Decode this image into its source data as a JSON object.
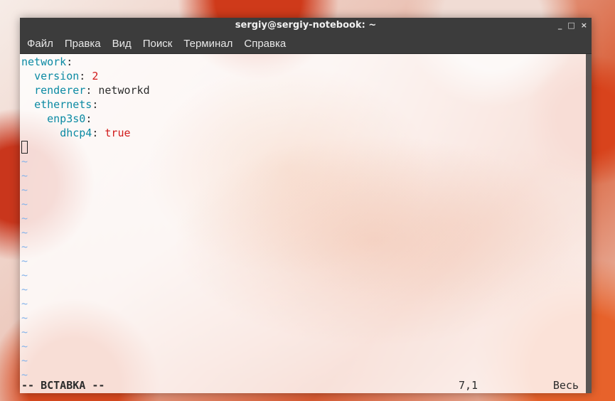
{
  "window": {
    "title": "sergiy@sergiy-notebook: ~",
    "controls": {
      "minimize": "_",
      "maximize": "□",
      "close": "×"
    }
  },
  "menu": {
    "items": [
      "Файл",
      "Правка",
      "Вид",
      "Поиск",
      "Терминал",
      "Справка"
    ]
  },
  "editor": {
    "lines": {
      "l1": {
        "key": "network",
        "sep": ":"
      },
      "l2": {
        "indent": "  ",
        "key": "version",
        "sep": ": ",
        "value": "2"
      },
      "l3": {
        "indent": "  ",
        "key": "renderer",
        "sep": ": ",
        "value": "networkd"
      },
      "l4": {
        "indent": "  ",
        "key": "ethernets",
        "sep": ":"
      },
      "l5": {
        "indent": "    ",
        "key": "enp3s0",
        "sep": ":"
      },
      "l6": {
        "indent": "      ",
        "key": "dhcp4",
        "sep": ": ",
        "value": "true"
      }
    },
    "tilde": "~",
    "tilde_count": 16,
    "status": {
      "mode": "-- ВСТАВКА --",
      "position": "7,1",
      "scroll": "Весь"
    },
    "colors": {
      "key": "#0b8aa3",
      "value": "#d11b1b",
      "tilde": "#86b4ea"
    }
  }
}
